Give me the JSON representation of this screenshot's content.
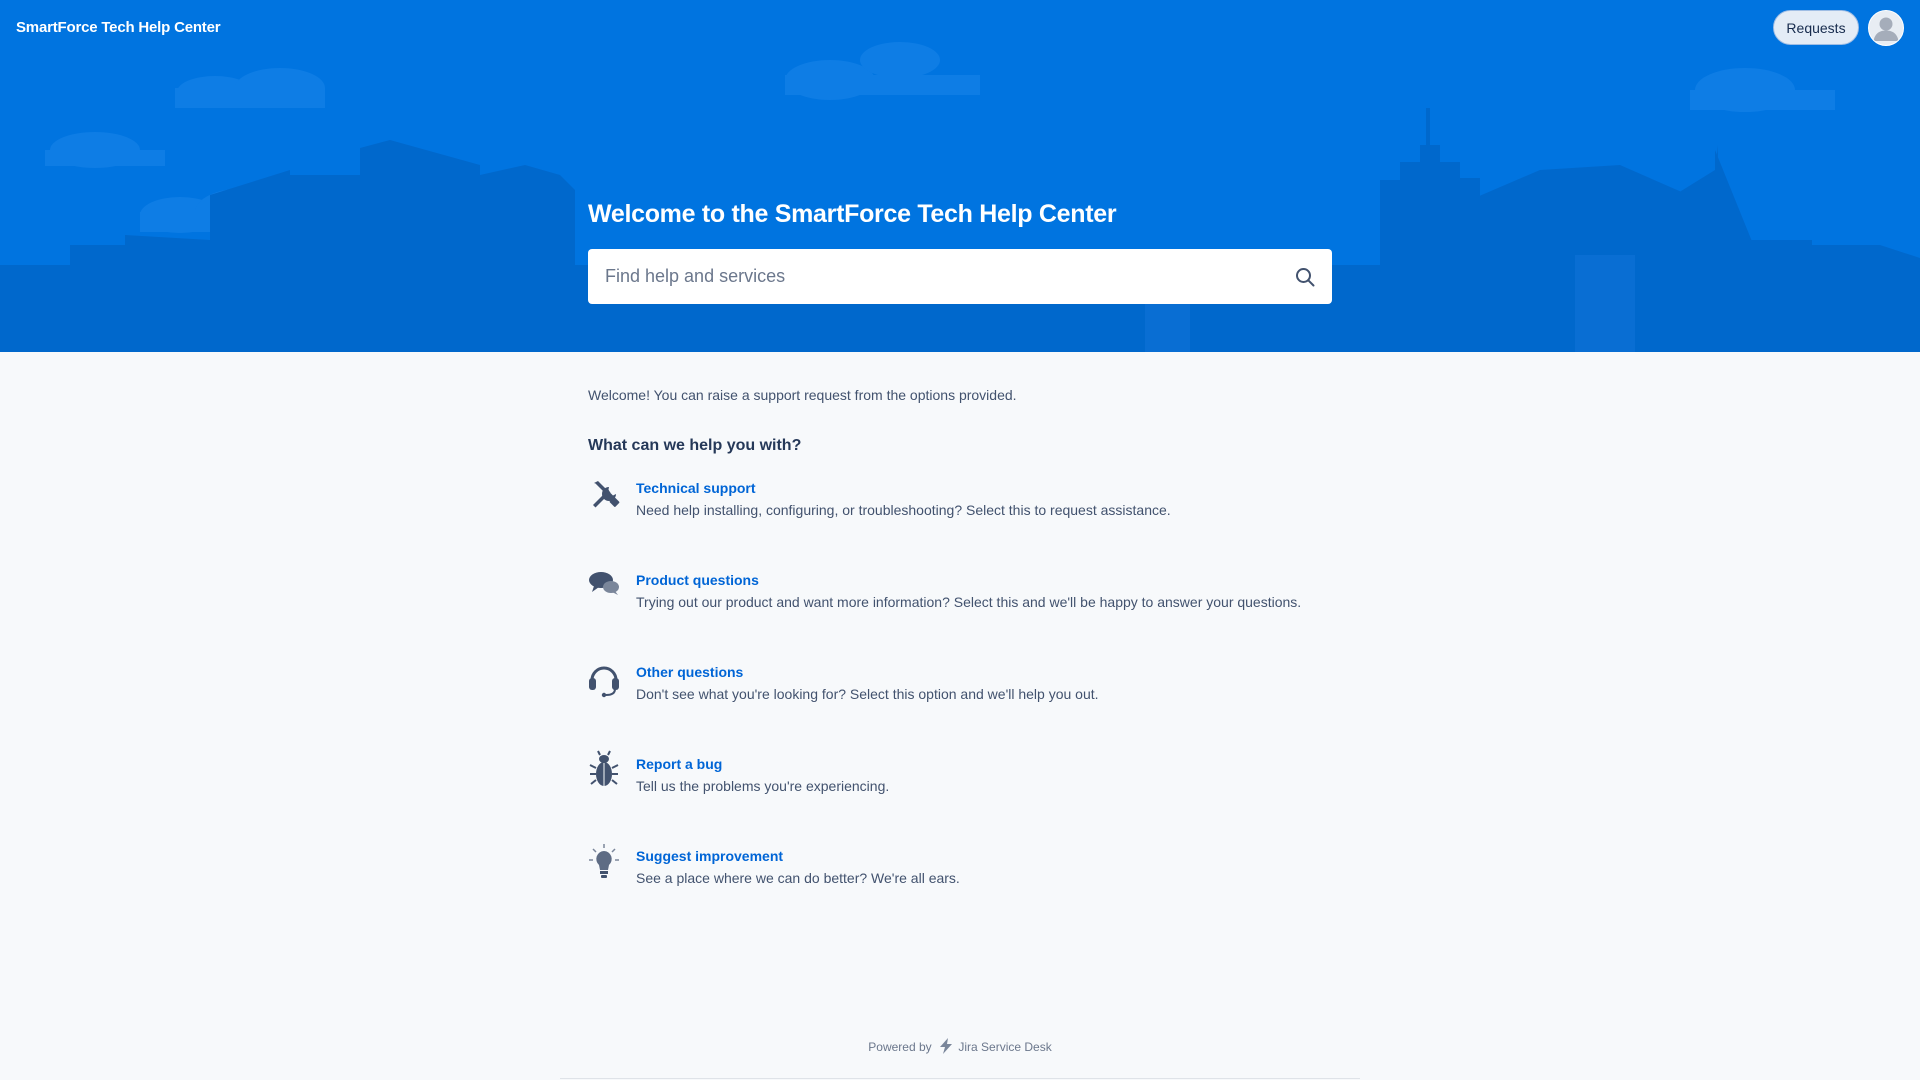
{
  "header": {
    "brand": "SmartForce Tech Help Center",
    "requests_label": "Requests",
    "avatar_icon": "user-avatar-icon"
  },
  "hero": {
    "title": "Welcome to the SmartForce Tech Help Center",
    "search_placeholder": "Find help and services",
    "search_icon": "search-icon",
    "background_color": "#0074e0"
  },
  "main": {
    "intro": "Welcome! You can raise a support request from the options provided.",
    "section_title": "What can we help you with?",
    "link_color": "#0065d6",
    "options": [
      {
        "title": "Technical support",
        "description": "Need help installing, configuring, or troubleshooting? Select this to request assistance.",
        "icon": "wrench-screwdriver-icon"
      },
      {
        "title": "Product questions",
        "description": "Trying out our product and want more information? Select this and we'll be happy to answer your questions.",
        "icon": "chat-bubbles-icon"
      },
      {
        "title": "Other questions",
        "description": "Don't see what you're looking for? Select this option and we'll help you out.",
        "icon": "headset-icon"
      },
      {
        "title": "Report a bug",
        "description": "Tell us the problems you're experiencing.",
        "icon": "bug-icon"
      },
      {
        "title": "Suggest improvement",
        "description": "See a place where we can do better? We're all ears.",
        "icon": "lightbulb-icon"
      }
    ]
  },
  "footer": {
    "powered_by": "Powered by",
    "product": "Jira Service Desk",
    "icon": "jira-bolt-icon"
  }
}
